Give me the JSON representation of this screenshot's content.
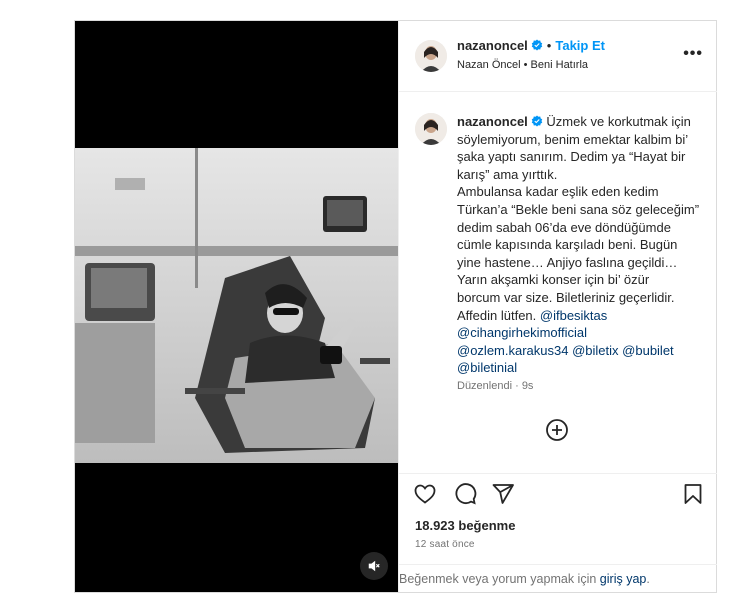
{
  "header": {
    "username": "nazanoncel",
    "separator": "•",
    "follow_label": "Takip Et",
    "subtitle": "Nazan Öncel • Beni Hatırla",
    "more_label": "•••"
  },
  "caption": {
    "username": "nazanoncel",
    "lines": [
      "Üzmek ve korkutmak için",
      "söylemiyorum, benim emektar kalbim bi’",
      "şaka yaptı sanırım. Dedim ya “Hayat bir",
      "karış” ama yırttık.",
      "Ambulansa kadar eşlik eden kedim",
      "Türkan’a “Bekle beni sana söz geleceğim”",
      "dedim sabah 06’da eve döndüğümde",
      "cümle kapısında karşıladı beni. Bugün",
      "yine hastene… Anjiyo faslına geçildi…",
      "Yarın akşamki konser için bi’ özür",
      "borcum var size. Biletleriniz geçerlidir.",
      "Affedin lütfen."
    ],
    "mentions": {
      "ifbesiktas": "@ifbesiktas",
      "cihangir": "@cihangirhekimofficial",
      "ozlem": "@ozlem.karakus34",
      "biletix": "@biletix",
      "bubilet": "@bubilet",
      "biletinial": "@biletinial"
    },
    "edited": "Düzenlendi · 9s"
  },
  "stats": {
    "likes": "18.923 beğenme",
    "time": "12 saat önce"
  },
  "footer": {
    "prefix": "Beğenmek veya yorum yapmak için",
    "login": "giriş yap",
    "suffix": "."
  },
  "icons": {
    "heart": "heart-icon",
    "comment": "comment-icon",
    "share": "share-icon",
    "save": "bookmark-icon",
    "add": "plus-circle-icon",
    "mute": "speaker-muted-icon",
    "verified": "verified-badge-icon"
  },
  "colors": {
    "accent": "#0095f6",
    "link": "#00376b",
    "muted": "#737373",
    "verified": "#0095f6"
  }
}
